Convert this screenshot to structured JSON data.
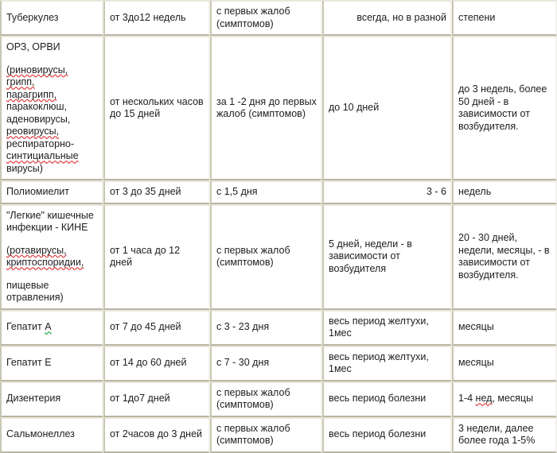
{
  "document": {
    "type": "table",
    "title": "Таблица периодов инфекционных заболеваний",
    "colors": {
      "cell_background": "#ffffff",
      "border_light": "#e9e7dc",
      "border_dark": "#b8b5a1",
      "text": "#1d1d1d",
      "spellcheck_red": "#e04a4a",
      "spellcheck_green": "#2aa84a"
    }
  },
  "table": {
    "columns": 5,
    "rows": [
      {
        "id": "tuberkulez",
        "c1": "Туберкулез",
        "c2": "от 3до12  недель",
        "c3": "с первых  жалоб\n(симптомов)",
        "c4": "всегда,  но в разной",
        "c5": "степени"
      },
      {
        "id": "orz-orvi",
        "c1_title": "ОРЗ, ОРВИ",
        "c1_list": [
          "(риновирусы,  грипп,",
          "парагрипп,",
          "паракоклюш,",
          "аденовирусы,",
          "реовирусы,",
          "респираторно-",
          "синтициальные",
          "вирусы)"
        ],
        "c2": "от нескольких часов\nдо 15 дней",
        "c3": "за 1 -2 дня до первых\nжалоб  (симптомов)",
        "c4": "до 10 дней",
        "c5": "до 3 недель,  более\n50 дней - в\nзависимости от\nвозбудителя."
      },
      {
        "id": "poliomielit",
        "c1": "Полиомиелит",
        "c2": "от 3 до 35 дней",
        "c3": "с 1,5 дня",
        "c4": "3 - 6",
        "c5": "недель"
      },
      {
        "id": "kine",
        "c1_title": "\"Легкие\"  кишечные\nинфекции - КИНЕ",
        "c1_list": [
          "(ротавирусы,",
          "криптоспоридии,"
        ],
        "c1_tail": "пищевые\nотравления)",
        "c2": "от 1 часа до 12 дней",
        "c3": "с первых  жалоб\n(симптомов)",
        "c4": "5 дней,  недели - в\nзависимости от\nвозбудителя",
        "c5": "20 - 30 дней,\nнедели,  месяцы, - в\nзависимости от\nвозбудителя."
      },
      {
        "id": "gepatit-a",
        "c1_pre": "Гепатит ",
        "c1_mark": "А",
        "c2": "от 7 до 45 дней",
        "c3": "с 3 - 23 дня",
        "c4": "весь период желтухи,\n1мес",
        "c5": "месяцы"
      },
      {
        "id": "gepatit-e",
        "c1": "Гепатит Е",
        "c2": "от 14 до 60 дней",
        "c3": "с 7 - 30 дня",
        "c4": "весь период желтухи,\n1мес",
        "c5": "месяцы"
      },
      {
        "id": "dizenteriya",
        "c1": "Дизентерия",
        "c2": "от 1до7  дней",
        "c3": "с первых  жалоб\n(симптомов)",
        "c4": "весь период болезни",
        "c5_pre": "1-4 ",
        "c5_mark": "нед",
        "c5_post": ",  месяцы"
      },
      {
        "id": "salmonellez",
        "c1": "Сальмонеллез",
        "c2": "от 2часов до 3 дней",
        "c3": "с первых  жалоб\n(симптомов)",
        "c4": "весь период болезни",
        "c5": "3 недели,  далее\nболее года 1-5%"
      }
    ]
  }
}
